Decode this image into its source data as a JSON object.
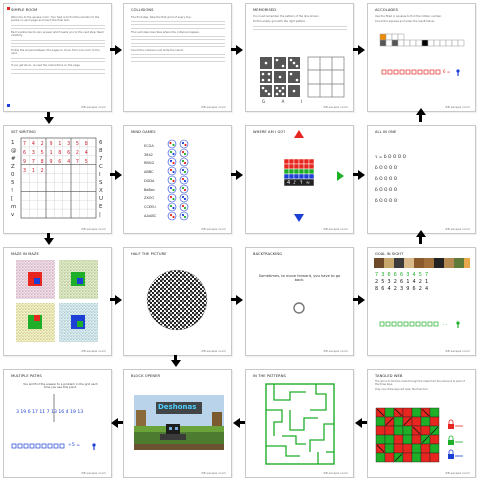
{
  "cards": {
    "simple_room": {
      "title": "SIMPLE ROOM",
      "paragraphs": [
        "Welcome to the escape room. Your task is to find the solution to the puzzle on each page and reach the final exit.",
        "Each puzzle has its own answer which leads you to the next step. Read carefully.",
        "Follow the arrows between the pages to move from one room to the next.",
        "If you get stuck, re-read the instructions on the page."
      ],
      "footer": "RB escape room"
    },
    "collisions": {
      "title": "COLLISIONS",
      "paragraphs": [
        "The first step: take the first word of every line.",
        "The next step describes where the collisions happen.",
        "Count the collisions and write the result."
      ],
      "footer": "RB escape room"
    },
    "memorized": {
      "title": "MEMORISED",
      "paragraphs": [
        "You must remember the pattern of the dice shown.",
        "Fill the empty grid with the right pattern."
      ],
      "letters": [
        "G",
        "A",
        "I"
      ],
      "footer": "RB escape room"
    },
    "accolades": {
      "title": "ACCOLADES",
      "paragraphs": [
        "Use the filled in squares to find the hidden number.",
        "Count the squares and enter the result below."
      ],
      "result": "6 =",
      "footer": "RB escape room"
    },
    "set_writing": {
      "title": "SET WRITING",
      "left_chars": [
        "1",
        "@",
        "#",
        "Z",
        "0",
        "5",
        "!",
        "[",
        "m",
        "v"
      ],
      "right_chars": [
        "6",
        "8",
        "7",
        "C",
        "I",
        "S",
        "X",
        "U",
        "E",
        "|"
      ],
      "digits": "7 4 2 9 1 3 5 8 6 3 5 1 8 6 2 4 9 7 8 9 6 4 7 5 3 1 2",
      "footer": "RB escape room"
    },
    "mind_games": {
      "title": "MIND GAMES",
      "words": [
        "ECGA",
        "3842",
        "RBGG",
        "ABBC",
        "DGDA",
        "BaBec",
        "ZXOO",
        "CCEEU",
        "AAABC"
      ],
      "footer": "RB escape room"
    },
    "where_am_i": {
      "title": "WHERE AM I GO?",
      "glyphs": "4 ♪ ↑ ≈",
      "footer": "RB escape room"
    },
    "all_in_one": {
      "title": "ALL IN ONE",
      "lines": [
        "ร = ɓ ʘ ʘ ʘ ʘ",
        "ɓ ʘ ʘ ʘ ʘ",
        "ɓ ʘ ʘ ʘ ʘ",
        "ɓ ʘ ʘ ʘ ʘ",
        "ɓ ʘ ʘ ʘ ʘ"
      ],
      "footer": "RB escape room"
    },
    "maze_in_maze": {
      "title": "MAZE IN MAZE",
      "footer": "RB escape room"
    },
    "half_the_picture": {
      "title": "HALF THE PICTURE",
      "footer": "RB escape room"
    },
    "backtracking": {
      "title": "BACKTRACKING",
      "text": "Sometimes, to move forward, you have to go back.",
      "footer": "RB escape room"
    },
    "goal_in_sight": {
      "title": "GOAL IN SIGHT",
      "digits_row1": "7 3 6 6 6 3 4 5 7",
      "digits_row2": "2 5 3 2 6 1 4 2 1",
      "digits_row3": "8 6 4 2 3 9 6 2 4",
      "footer": "RB escape room"
    },
    "multiple_paths": {
      "title": "MULTIPLE PATHS",
      "intro": "You will find the answer to a problem in the grid each time you see this point.",
      "numbers": "3 19 6 17 11 7 13 16 4 19 13",
      "result": "+5 =",
      "footer": "RB escape room"
    },
    "block_opener": {
      "title": "BLOCK OPENER",
      "sign": "Deshonas",
      "footer": "RB escape room"
    },
    "in_the_patterns": {
      "title": "IN THE PATTERNS",
      "footer": "RB escape room"
    },
    "tangled_web": {
      "title": "TANGLED WEB",
      "paragraphs": [
        "The aim is to find the route through the maze from the entrance to each of the three keys.",
        "Only one of the keys will open the final door."
      ],
      "footer": "RB escape room"
    }
  },
  "colors": {
    "arrow": "#000000",
    "red": "#e6261f",
    "green": "#1fae28",
    "blue": "#1c3fd6",
    "orange": "#f08a00"
  }
}
